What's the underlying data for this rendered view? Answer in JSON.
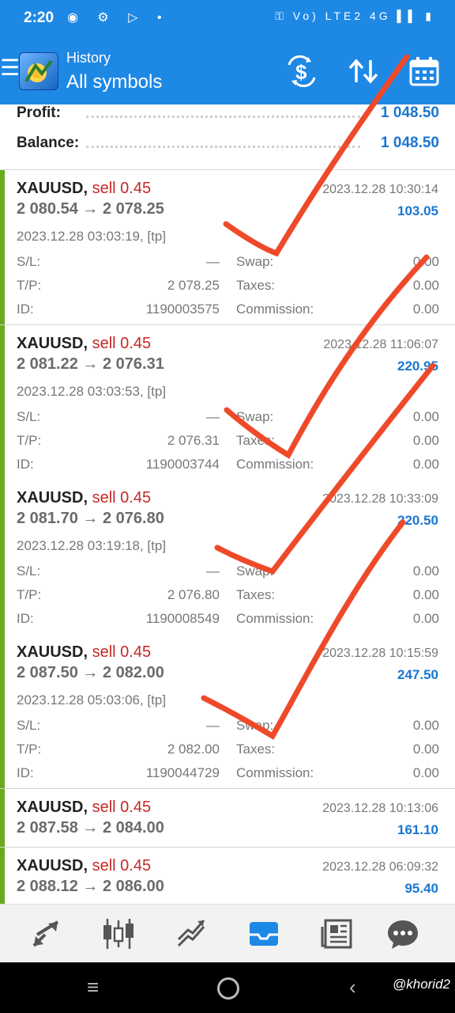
{
  "status_bar": {
    "time": "2:20",
    "left_icons": "◉ ⚙ ▷ •",
    "right_icons": "⚿ Vo) LTE2 4G ▌▌ ▮"
  },
  "header": {
    "subtitle": "History",
    "title": "All symbols"
  },
  "summary": {
    "profit_label": "Profit:",
    "profit_value": "1 048.50",
    "balance_label": "Balance:",
    "balance_value": "1 048.50"
  },
  "deals": [
    {
      "symbol": "XAUUSD,",
      "side": "sell 0.45",
      "prices": "2 080.54 → 2 078.25",
      "close_time": "2023.12.28 10:30:14",
      "profit": "103.05",
      "open_info": "2023.12.28 03:03:19, [tp]",
      "sl_label": "S/L:",
      "sl": "—",
      "swap_label": "Swap:",
      "swap": "0.00",
      "tp_label": "T/P:",
      "tp": "2 078.25",
      "taxes_label": "Taxes:",
      "taxes": "0.00",
      "id_label": "ID:",
      "id": "1190003575",
      "commission_label": "Commission:",
      "commission": "0.00"
    },
    {
      "symbol": "XAUUSD,",
      "side": "sell 0.45",
      "prices": "2 081.22 → 2 076.31",
      "close_time": "2023.12.28 11:06:07",
      "profit": "220.95",
      "open_info": "2023.12.28 03:03:53, [tp]",
      "sl_label": "S/L:",
      "sl": "—",
      "swap_label": "Swap:",
      "swap": "0.00",
      "tp_label": "T/P:",
      "tp": "2 076.31",
      "taxes_label": "Taxes:",
      "taxes": "0.00",
      "id_label": "ID:",
      "id": "1190003744",
      "commission_label": "Commission:",
      "commission": "0.00"
    },
    {
      "symbol": "XAUUSD,",
      "side": "sell 0.45",
      "prices": "2 081.70 → 2 076.80",
      "close_time": "2023.12.28 10:33:09",
      "profit": "220.50",
      "open_info": "2023.12.28 03:19:18, [tp]",
      "sl_label": "S/L:",
      "sl": "—",
      "swap_label": "Swap:",
      "swap": "0.00",
      "tp_label": "T/P:",
      "tp": "2 076.80",
      "taxes_label": "Taxes:",
      "taxes": "0.00",
      "id_label": "ID:",
      "id": "1190008549",
      "commission_label": "Commission:",
      "commission": "0.00"
    },
    {
      "symbol": "XAUUSD,",
      "side": "sell 0.45",
      "prices": "2 087.50 → 2 082.00",
      "close_time": "2023.12.28 10:15:59",
      "profit": "247.50",
      "open_info": "2023.12.28 05:03:06, [tp]",
      "sl_label": "S/L:",
      "sl": "—",
      "swap_label": "Swap:",
      "swap": "0.00",
      "tp_label": "T/P:",
      "tp": "2 082.00",
      "taxes_label": "Taxes:",
      "taxes": "0.00",
      "id_label": "ID:",
      "id": "1190044729",
      "commission_label": "Commission:",
      "commission": "0.00"
    },
    {
      "symbol": "XAUUSD,",
      "side": "sell 0.45",
      "prices": "2 087.58 → 2 084.00",
      "close_time": "2023.12.28 10:13:06",
      "profit": "161.10"
    },
    {
      "symbol": "XAUUSD,",
      "side": "sell 0.45",
      "prices": "2 088.12 → 2 086.00",
      "close_time": "2023.12.28 06:09:32",
      "profit": "95.40"
    }
  ],
  "bottom_nav": [
    "trade-icon",
    "chart-icon",
    "quotes-icon",
    "history-icon",
    "news-icon",
    "chat-icon"
  ],
  "system_nav": {
    "menu": "≡",
    "back": "‹",
    "watermark": "@khorid2"
  },
  "colors": {
    "primary": "#1e88e5",
    "sell": "#c62828",
    "profit": "#1976d2",
    "accent": "#6aaa1e",
    "annotation": "#ee4a2a"
  }
}
